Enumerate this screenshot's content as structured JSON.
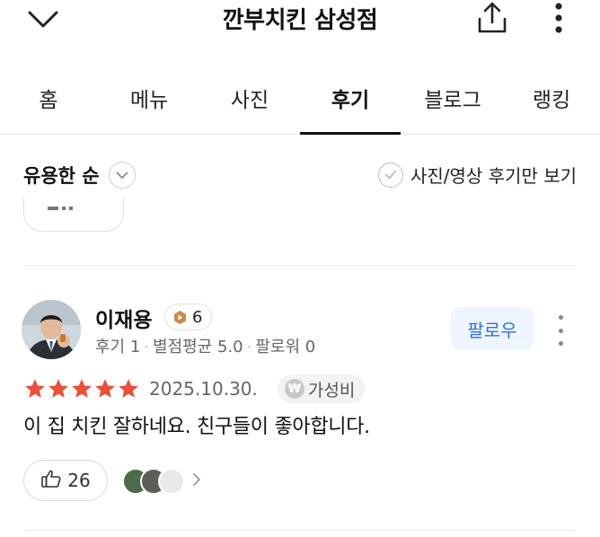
{
  "header": {
    "title": "깐부치킨 삼성점",
    "back_icon": "chevron-down-icon",
    "share_icon": "share-icon",
    "more_icon": "more-vertical-icon"
  },
  "tabs": [
    {
      "label": "홈",
      "active": false
    },
    {
      "label": "메뉴",
      "active": false
    },
    {
      "label": "사진",
      "active": false
    },
    {
      "label": "후기",
      "active": true
    },
    {
      "label": "블로그",
      "active": false
    },
    {
      "label": "랭킹",
      "active": false
    }
  ],
  "filter": {
    "sort_label": "유용한 순",
    "photo_only_label": "사진/영상 후기만 보기"
  },
  "review": {
    "author": "이재용",
    "level": "6",
    "stats": [
      "후기 1",
      "별점평균 5.0",
      "팔로워 0"
    ],
    "follow_label": "팔로우",
    "rating": 5,
    "date": "2025.10.30.",
    "tag_icon": "₩",
    "tag": "가성비",
    "text": "이 집 치킨 잘하네요. 친구들이 좋아합니다.",
    "likes": "26"
  },
  "colors": {
    "accent_blue": "#2b73e0",
    "follow_bg": "#eef5ff",
    "star": "#e8503a",
    "level_badge": "#c98a4b"
  }
}
